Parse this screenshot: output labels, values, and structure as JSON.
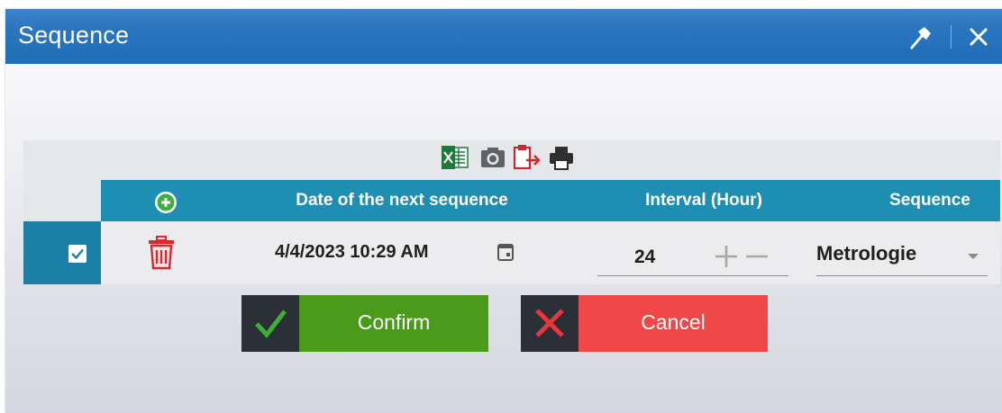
{
  "window": {
    "title": "Sequence",
    "titlebar_icons": [
      "pin-icon",
      "close-icon"
    ]
  },
  "toolbar": {
    "icons": [
      "excel-export-icon",
      "camera-icon",
      "clipboard-export-icon",
      "print-icon"
    ]
  },
  "grid": {
    "columns": {
      "add_icon": "add-circle-icon",
      "date": "Date of the next sequence",
      "interval": "Interval (Hour)",
      "sequence": "Sequence"
    },
    "rows": [
      {
        "selected": true,
        "date": "4/4/2023 10:29 AM",
        "interval": "24",
        "sequence": "Metrologie"
      }
    ]
  },
  "actions": {
    "confirm": "Confirm",
    "cancel": "Cancel"
  },
  "colors": {
    "titlebar": "#1f6db7",
    "header": "#1e8fb3",
    "select_cell": "#1b7fa6",
    "confirm": "#4a9a1c",
    "cancel": "#f04848",
    "delete_icon": "#e0262c",
    "add_icon": "#3fae3f"
  }
}
